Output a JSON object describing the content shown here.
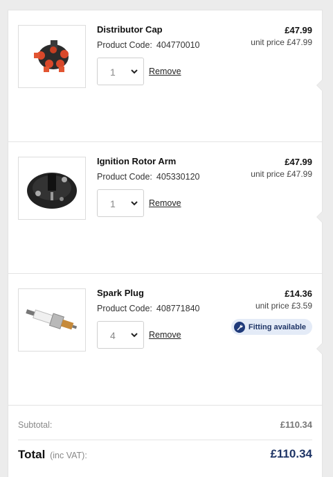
{
  "cart": {
    "items": [
      {
        "name": "Distributor Cap",
        "code_label": "Product Code:",
        "code": "404770010",
        "qty": "1",
        "remove_label": "Remove",
        "price": "£47.99",
        "unit_price": "unit price £47.99",
        "image": "distributor-cap"
      },
      {
        "name": "Ignition Rotor Arm",
        "code_label": "Product Code:",
        "code": "405330120",
        "qty": "1",
        "remove_label": "Remove",
        "price": "£47.99",
        "unit_price": "unit price £47.99",
        "image": "ignition-rotor-arm"
      },
      {
        "name": "Spark Plug",
        "code_label": "Product Code:",
        "code": "408771840",
        "qty": "4",
        "remove_label": "Remove",
        "price": "£14.36",
        "unit_price": "unit price £3.59",
        "badge": "Fitting available",
        "image": "spark-plug"
      }
    ]
  },
  "summary": {
    "subtotal_label": "Subtotal:",
    "subtotal_value": "£110.34",
    "total_label": "Total",
    "total_sub": "(inc VAT):",
    "total_value": "£110.34"
  },
  "colors": {
    "accent": "#1f3566",
    "badge_bg": "#e4ebf7",
    "border": "#e3e3e3",
    "background": "#ececec"
  },
  "icons": [
    "chevron-down-icon",
    "wrench-icon"
  ]
}
